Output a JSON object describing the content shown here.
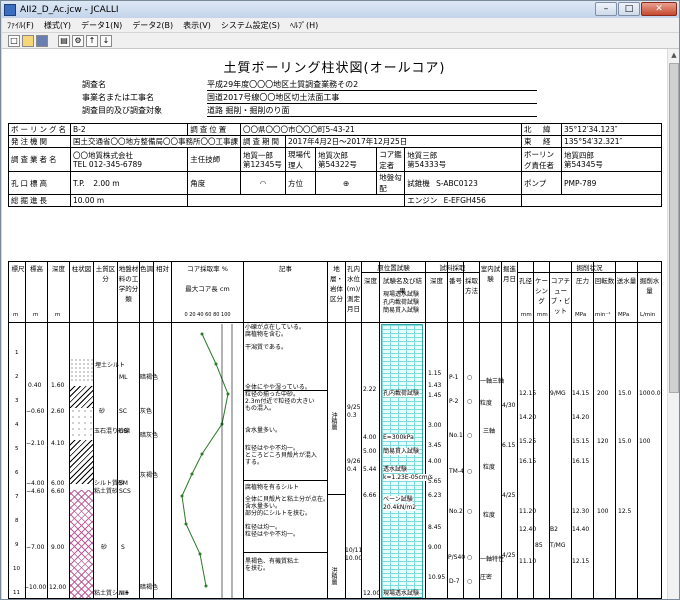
{
  "window": {
    "title": "AII2_D_Ac.jcw - JCALLI",
    "buttons": {
      "minimize": "–",
      "maximize": "□",
      "close": "✕"
    }
  },
  "menu": [
    "ﾌｧｲﾙ(F)",
    "様式(Y)",
    "データ1(N)",
    "データ2(B)",
    "表示(V)",
    "システム設定(S)",
    "ﾍﾙﾌﾟ(H)"
  ],
  "toolbar": [
    "new-doc-icon",
    "open-folder-icon",
    "save-icon",
    "print-icon",
    "settings-icon",
    "up-arrow-icon",
    "down-arrow-icon"
  ],
  "doc": {
    "title": "土質ボーリング柱状図(オールコア)",
    "header": [
      {
        "label": "調査名",
        "value": "平成29年度〇〇〇地区土質調査業務その2"
      },
      {
        "label": "事業名または工事名",
        "value": "国道2017号線〇〇地区切土法面工事"
      },
      {
        "label": "調査目的及び調査対象",
        "value": "道路  掘削・掘削のり面"
      }
    ],
    "info": {
      "boring_name_label": "ボーリング名",
      "boring_name": "B-2",
      "location_label": "調査位置",
      "location": "〇〇県〇〇〇市〇〇〇町5-43-21",
      "lat_label": "北　緯",
      "lat": "35°12′34.123″",
      "orderer_label": "発注機関",
      "orderer": "国土交通省〇〇地方整備局〇〇事務所〇〇工事課",
      "period_label": "調査期間",
      "period": "2017年4月2日～2017年12月25日",
      "lon_label": "東　経",
      "lon": "135°54′32.321″",
      "company_label": "調査業者名",
      "company": "〇〇地質株式会社",
      "company_tel": "TEL 012-345-6789",
      "engineer_label": "主任技師",
      "engineer": "地質一郎",
      "engineer_no": "第12345号",
      "site_agent_label": "現場代理人",
      "site_agent": "地質次郎",
      "site_agent_no": "第54322号",
      "core_label": "コア鑑定者",
      "core": "地質三郎",
      "core_no": "第54333号",
      "boring_op_label": "ボーリング責任者",
      "boring_op": "地質四郎",
      "boring_op_no": "第54345号",
      "elev_label": "孔口標高",
      "elev_tp": "T.P.",
      "elev": "2.00 m",
      "angle_label": "角度",
      "dir_label": "方位",
      "slope_label": "地盤勾配",
      "machine_label": "試錐機",
      "machine": "S-ABC0123",
      "depth_label": "総掘進長",
      "depth": "10.00 m",
      "engine_label": "エンジン",
      "engine": "E-EFGH456",
      "pump_label": "ポンプ",
      "pump": "PMP-789"
    },
    "log_headers": {
      "scale": "標尺",
      "elev": "標高",
      "depth": "深度",
      "column": "柱状図",
      "soil": "土質区分",
      "material": "地盤材料の工学的分類",
      "color": "色調",
      "relative": "相対",
      "core_rate": "コア採取率 %",
      "max_core": "最大コア長 cm",
      "desc": "記事",
      "geology": "地層・岩体区分",
      "water": "孔内水位(m)/測定月日",
      "test_title": "原位置試験",
      "test_depth": "深度",
      "test_name": "試験名及び結果",
      "sample_title": "試料採取",
      "sample_depth": "深度",
      "sample_no": "番号",
      "sample_method": "採取方法",
      "indoor": "室内試験",
      "dig_date": "掘進月日",
      "drill_title": "掘削状況",
      "drill_dia": "孔径",
      "casing": "ケーシング",
      "bit": "コアチューブ・ビット",
      "pressure": "圧力",
      "speed": "回転数",
      "water_feed": "送水量",
      "mud": "泥水比重",
      "return": "掘削水量",
      "units": [
        "m",
        "m",
        "m",
        "",
        "",
        "",
        "",
        "",
        "",
        "",
        "",
        "",
        "m",
        "",
        "",
        "",
        "",
        "",
        "",
        "",
        "",
        "mm",
        "mm",
        "",
        "MPa",
        "min⁻¹",
        "MPa",
        "L/min",
        "L/min"
      ],
      "core_scale": "0  20  40  60  80  100"
    },
    "scale_labels": [
      "1",
      "2",
      "3",
      "4",
      "5",
      "6",
      "7",
      "8",
      "9",
      "10",
      "11",
      "12"
    ],
    "layers": [
      {
        "elev": "0.40",
        "depth": "1.60",
        "name": "埋土シルト",
        "code": "ML"
      },
      {
        "elev": "−0.60",
        "depth": "2.60",
        "name": "砂",
        "code": "SC"
      },
      {
        "elev": "−2.10",
        "depth": "4.10",
        "name": "玉石混り砂礫",
        "code": "GS"
      },
      {
        "elev": "−4.00",
        "depth": "6.00",
        "name": "シルト質砂",
        "code": "SM"
      },
      {
        "elev": "−4.60",
        "depth": "6.60",
        "name": "粘土質砂",
        "code": "SCS"
      },
      {
        "elev": "−7.00",
        "depth": "9.00",
        "name": "砂",
        "code": "S"
      },
      {
        "elev": "−10.00",
        "depth": "12.00",
        "name": "粘土質シルト",
        "code": "MH"
      }
    ],
    "colors": [
      "暗褐色",
      "灰色",
      "暗灰色",
      "灰褐色",
      "暗褐色"
    ],
    "descriptions": [
      "小礫が点在している。",
      "腐植物を含む。",
      "干潟質である。",
      "全体にやや湿っている。",
      "粒径の揃った中砂。",
      "2.3m付近で粒径の大きい",
      "もの混入。",
      "含水量多い。",
      "粒径はやや不均一。",
      "ところどころ貝殻片が混入",
      "する。",
      "腐植物を有るシルト",
      "全体に貝殻片と粘土分が点在。",
      "含水量多い。",
      "部分的にシルトを挟む。",
      "粒径は均一。",
      "粒径はやや不均一。",
      "黒褐色、有機質粘土",
      "を挟む。"
    ],
    "geology": [
      "沖積層",
      "洪積層"
    ],
    "water_levels": [
      {
        "label": "0.3",
        "date": "9/25"
      },
      {
        "label": "0.4",
        "date": "9/26"
      },
      {
        "label": "10.00",
        "date": "10/11"
      }
    ],
    "tests": [
      {
        "depth": "2.22",
        "name": "孔内載荷試験"
      },
      {
        "depth": "4.00",
        "name": "E=300kPa"
      },
      {
        "depth": "5.00",
        "name": "簡易貫入試験"
      },
      {
        "depth": "5.44",
        "name": "透水試験"
      },
      {
        "depth": "",
        "name": "k=1.23E-05cm/s"
      },
      {
        "depth": "6.66",
        "name": "ベーン試験"
      },
      {
        "depth": "",
        "name": "20.4kN/m2"
      },
      {
        "depth": "12.00",
        "name": "現場透水試験"
      }
    ],
    "test_list": [
      "現場透水試験",
      "孔内載荷試験",
      "簡易貫入試験"
    ],
    "samples": [
      {
        "depth": "1.15",
        "no": "P-1",
        "method": "○"
      },
      {
        "depth": "1.43",
        "no": "",
        "method": ""
      },
      {
        "depth": "1.45",
        "no": "P-2",
        "method": "○"
      },
      {
        "depth": "3.00",
        "no": "No.1",
        "method": "○"
      },
      {
        "depth": "3.45",
        "no": "",
        "method": ""
      },
      {
        "depth": "4.00",
        "no": "TM-4",
        "method": "○"
      },
      {
        "depth": "5.65",
        "no": "",
        "method": ""
      },
      {
        "depth": "6.23",
        "no": "No.2",
        "method": "○"
      },
      {
        "depth": "8.45",
        "no": "",
        "method": ""
      },
      {
        "depth": "9.00",
        "no": "P/S40",
        "method": "○"
      },
      {
        "depth": "10.95",
        "no": "D-7",
        "method": "○"
      }
    ],
    "indoor_tests": [
      "一軸三軸",
      "粒度",
      "三軸",
      "粒度",
      "一軸特性",
      "圧密",
      "粒度"
    ],
    "drilling": [
      {
        "dia": "12.15",
        "bit": "9/MG",
        "pressure": "14.15",
        "speed": "200",
        "water": "15.0",
        "mud": "100",
        "ret": "0.0"
      },
      {
        "dia": "14.20",
        "bit": "",
        "pressure": "14.20",
        "speed": "",
        "water": "",
        "mud": "",
        "ret": ""
      },
      {
        "dia": "15.25",
        "bit": "",
        "pressure": "15.15",
        "speed": "120",
        "water": "15.0",
        "mud": "100",
        "ret": ""
      },
      {
        "dia": "16.15",
        "bit": "",
        "pressure": "16.15",
        "speed": "",
        "water": "",
        "mud": "",
        "ret": ""
      },
      {
        "dia": "11.20",
        "bit": "",
        "pressure": "12.30",
        "speed": "100",
        "water": "12.5",
        "mud": "",
        "ret": ""
      },
      {
        "dia": "12.40",
        "bit": "B2",
        "pressure": "14.40",
        "speed": "",
        "water": "",
        "mud": "",
        "ret": ""
      },
      {
        "dia": "85",
        "bit": "T/MG",
        "pressure": "",
        "speed": "",
        "water": "",
        "mud": "",
        "ret": ""
      },
      {
        "dia": "11.10",
        "bit": "",
        "pressure": "12.15",
        "speed": "",
        "water": "",
        "mud": "",
        "ret": ""
      }
    ],
    "cond_notes": [
      "4/30",
      "6.15",
      "4/25",
      "4/25"
    ]
  }
}
